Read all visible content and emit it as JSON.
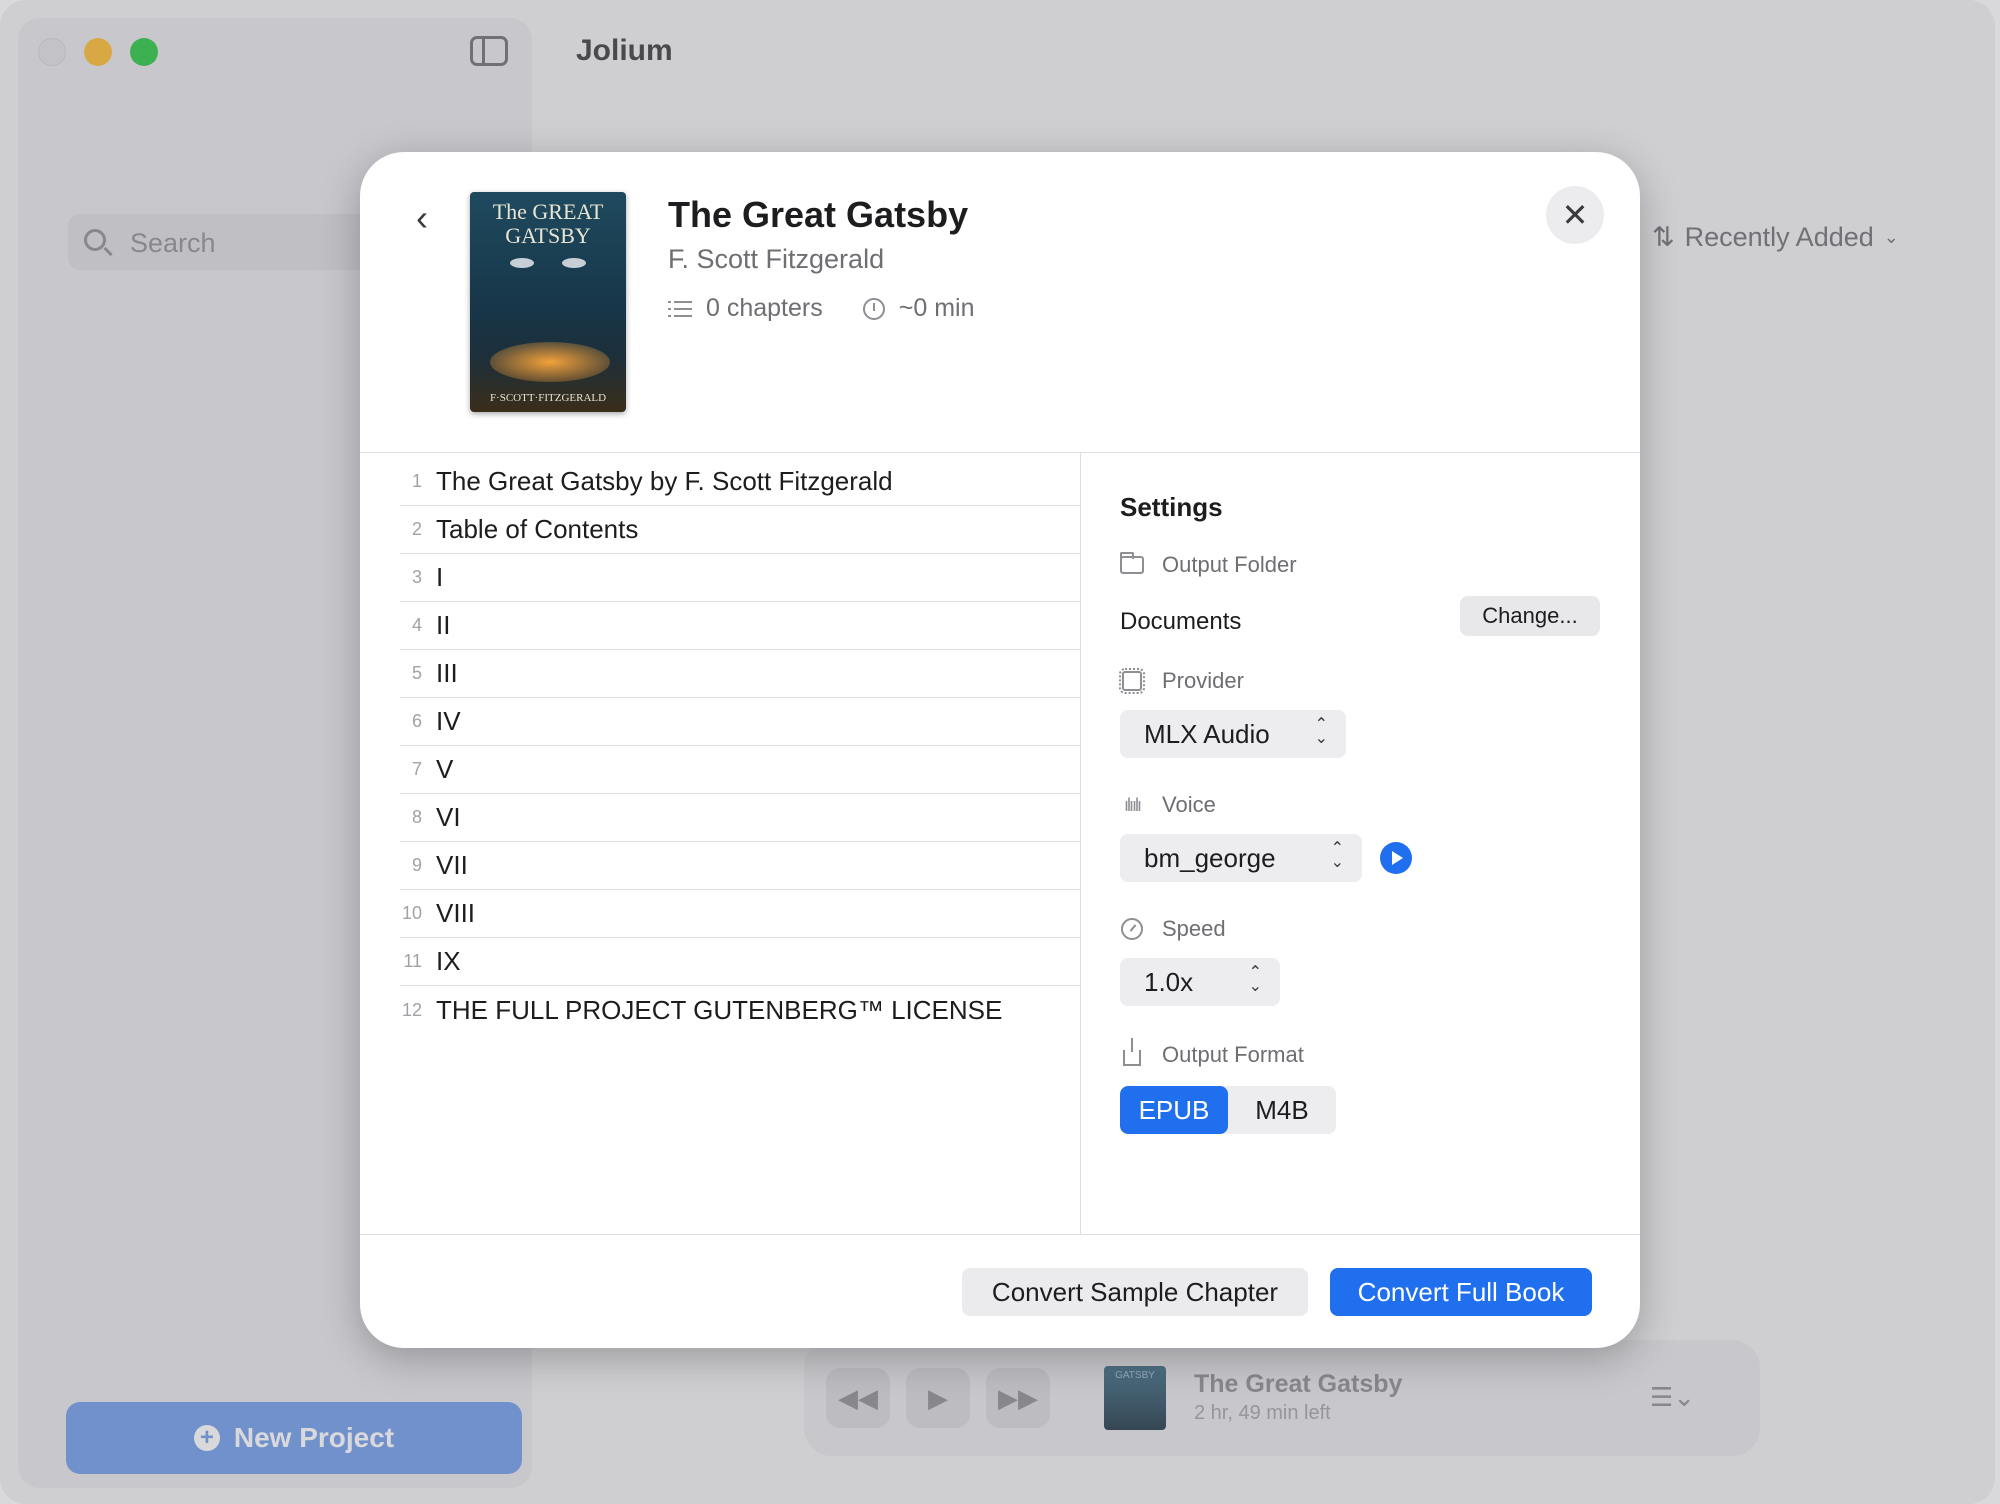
{
  "app": {
    "title": "Jolium",
    "search_placeholder": "Search",
    "sort_label": "Recently Added",
    "new_project_label": "New Project"
  },
  "player": {
    "cover_text": "GATSBY",
    "title": "The Great Gatsby",
    "subtitle": "2 hr, 49 min left"
  },
  "book": {
    "title": "The Great Gatsby",
    "author": "F. Scott Fitzgerald",
    "chapters_count": "0 chapters",
    "duration": "~0 min",
    "cover": {
      "title_line1": "The GREAT",
      "title_line2": "GATSBY",
      "author": "F·SCOTT·FITZGERALD"
    }
  },
  "chapters": [
    {
      "num": "1",
      "title": "The Great Gatsby by F. Scott Fitzgerald"
    },
    {
      "num": "2",
      "title": "Table of Contents"
    },
    {
      "num": "3",
      "title": "I"
    },
    {
      "num": "4",
      "title": "II"
    },
    {
      "num": "5",
      "title": "III"
    },
    {
      "num": "6",
      "title": "IV"
    },
    {
      "num": "7",
      "title": "V"
    },
    {
      "num": "8",
      "title": "VI"
    },
    {
      "num": "9",
      "title": "VII"
    },
    {
      "num": "10",
      "title": "VIII"
    },
    {
      "num": "11",
      "title": "IX"
    },
    {
      "num": "12",
      "title": "THE FULL PROJECT GUTENBERG™ LICENSE"
    }
  ],
  "settings": {
    "title": "Settings",
    "output_folder_label": "Output Folder",
    "output_folder_value": "Documents",
    "change_label": "Change...",
    "provider_label": "Provider",
    "provider_value": "MLX Audio",
    "voice_label": "Voice",
    "voice_value": "bm_george",
    "speed_label": "Speed",
    "speed_value": "1.0x",
    "output_format_label": "Output Format",
    "formats": [
      "EPUB",
      "M4B"
    ],
    "selected_format": "EPUB"
  },
  "actions": {
    "sample_label": "Convert Sample Chapter",
    "full_label": "Convert Full Book"
  },
  "colors": {
    "accent": "#1f6fef",
    "traffic_yellow": "#febc2e",
    "traffic_green": "#28c840"
  }
}
